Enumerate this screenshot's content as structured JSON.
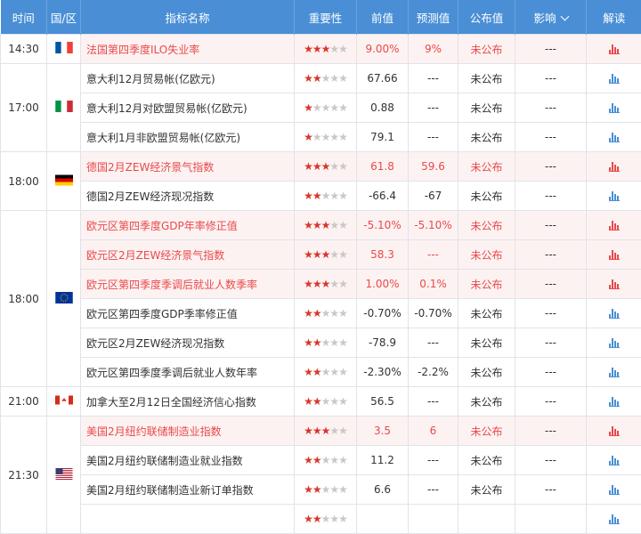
{
  "headers": {
    "time": "时间",
    "region": "国/区",
    "indicator": "指标名称",
    "importance": "重要性",
    "previous": "前值",
    "forecast": "预测值",
    "published": "公布值",
    "impact": "影响",
    "analysis": "解读"
  },
  "colors": {
    "header_bg": "#4a8fd6",
    "important_text": "#e84a4a",
    "important_bg": "#fdf2f2",
    "star_on": "#d9362b",
    "star_off": "#c8c8c8",
    "bar_red": "#e84a4a",
    "bar_blue": "#4a8fd6"
  },
  "groups": [
    {
      "time": "14:30",
      "flag": "france-flag",
      "rows": [
        {
          "name": "法国第四季度ILO失业率",
          "stars": 3,
          "previous": "9.00%",
          "forecast": "9%",
          "published": "未公布",
          "impact": "---",
          "important": true
        }
      ]
    },
    {
      "time": "17:00",
      "flag": "italy-flag",
      "rows": [
        {
          "name": "意大利12月贸易帐(亿欧元)",
          "stars": 2,
          "previous": "67.66",
          "forecast": "---",
          "published": "未公布",
          "impact": "---",
          "important": false
        },
        {
          "name": "意大利12月对欧盟贸易帐(亿欧元)",
          "stars": 1,
          "previous": "0.88",
          "forecast": "---",
          "published": "未公布",
          "impact": "---",
          "important": false
        },
        {
          "name": "意大利1月非欧盟贸易帐(亿欧元)",
          "stars": 1,
          "previous": "79.1",
          "forecast": "---",
          "published": "未公布",
          "impact": "---",
          "important": false
        }
      ]
    },
    {
      "time": "18:00",
      "flag": "germany-flag",
      "rows": [
        {
          "name": "德国2月ZEW经济景气指数",
          "stars": 3,
          "previous": "61.8",
          "forecast": "59.6",
          "published": "未公布",
          "impact": "---",
          "important": true
        },
        {
          "name": "德国2月ZEW经济现况指数",
          "stars": 2,
          "previous": "-66.4",
          "forecast": "-67",
          "published": "未公布",
          "impact": "---",
          "important": false
        }
      ]
    },
    {
      "time": "18:00",
      "flag": "eu-flag",
      "rows": [
        {
          "name": "欧元区第四季度GDP年率修正值",
          "stars": 3,
          "previous": "-5.10%",
          "forecast": "-5.10%",
          "published": "未公布",
          "impact": "---",
          "important": true
        },
        {
          "name": "欧元区2月ZEW经济景气指数",
          "stars": 3,
          "previous": "58.3",
          "forecast": "---",
          "published": "未公布",
          "impact": "---",
          "important": true
        },
        {
          "name": "欧元区第四季度季调后就业人数季率",
          "stars": 3,
          "previous": "1.00%",
          "forecast": "0.1%",
          "published": "未公布",
          "impact": "---",
          "important": true
        },
        {
          "name": "欧元区第四季度GDP季率修正值",
          "stars": 2,
          "previous": "-0.70%",
          "forecast": "-0.70%",
          "published": "未公布",
          "impact": "---",
          "important": false
        },
        {
          "name": "欧元区2月ZEW经济现况指数",
          "stars": 2,
          "previous": "-78.9",
          "forecast": "---",
          "published": "未公布",
          "impact": "---",
          "important": false
        },
        {
          "name": "欧元区第四季度季调后就业人数年率",
          "stars": 2,
          "previous": "-2.30%",
          "forecast": "-2.2%",
          "published": "未公布",
          "impact": "---",
          "important": false
        }
      ]
    },
    {
      "time": "21:00",
      "flag": "canada-flag",
      "rows": [
        {
          "name": "加拿大至2月12日全国经济信心指数",
          "stars": 2,
          "previous": "56.5",
          "forecast": "---",
          "published": "未公布",
          "impact": "---",
          "important": false
        }
      ]
    },
    {
      "time": "21:30",
      "flag": "usa-flag",
      "rows": [
        {
          "name": "美国2月纽约联储制造业指数",
          "stars": 3,
          "previous": "3.5",
          "forecast": "6",
          "published": "未公布",
          "impact": "---",
          "important": true
        },
        {
          "name": "美国2月纽约联储制造业就业指数",
          "stars": 2,
          "previous": "11.2",
          "forecast": "---",
          "published": "未公布",
          "impact": "---",
          "important": false
        },
        {
          "name": "美国2月纽约联储制造业新订单指数",
          "stars": 2,
          "previous": "6.6",
          "forecast": "---",
          "published": "未公布",
          "impact": "---",
          "important": false
        },
        {
          "name": "",
          "stars": 2,
          "previous": "",
          "forecast": "",
          "published": "",
          "impact": "",
          "important": false
        }
      ]
    }
  ]
}
